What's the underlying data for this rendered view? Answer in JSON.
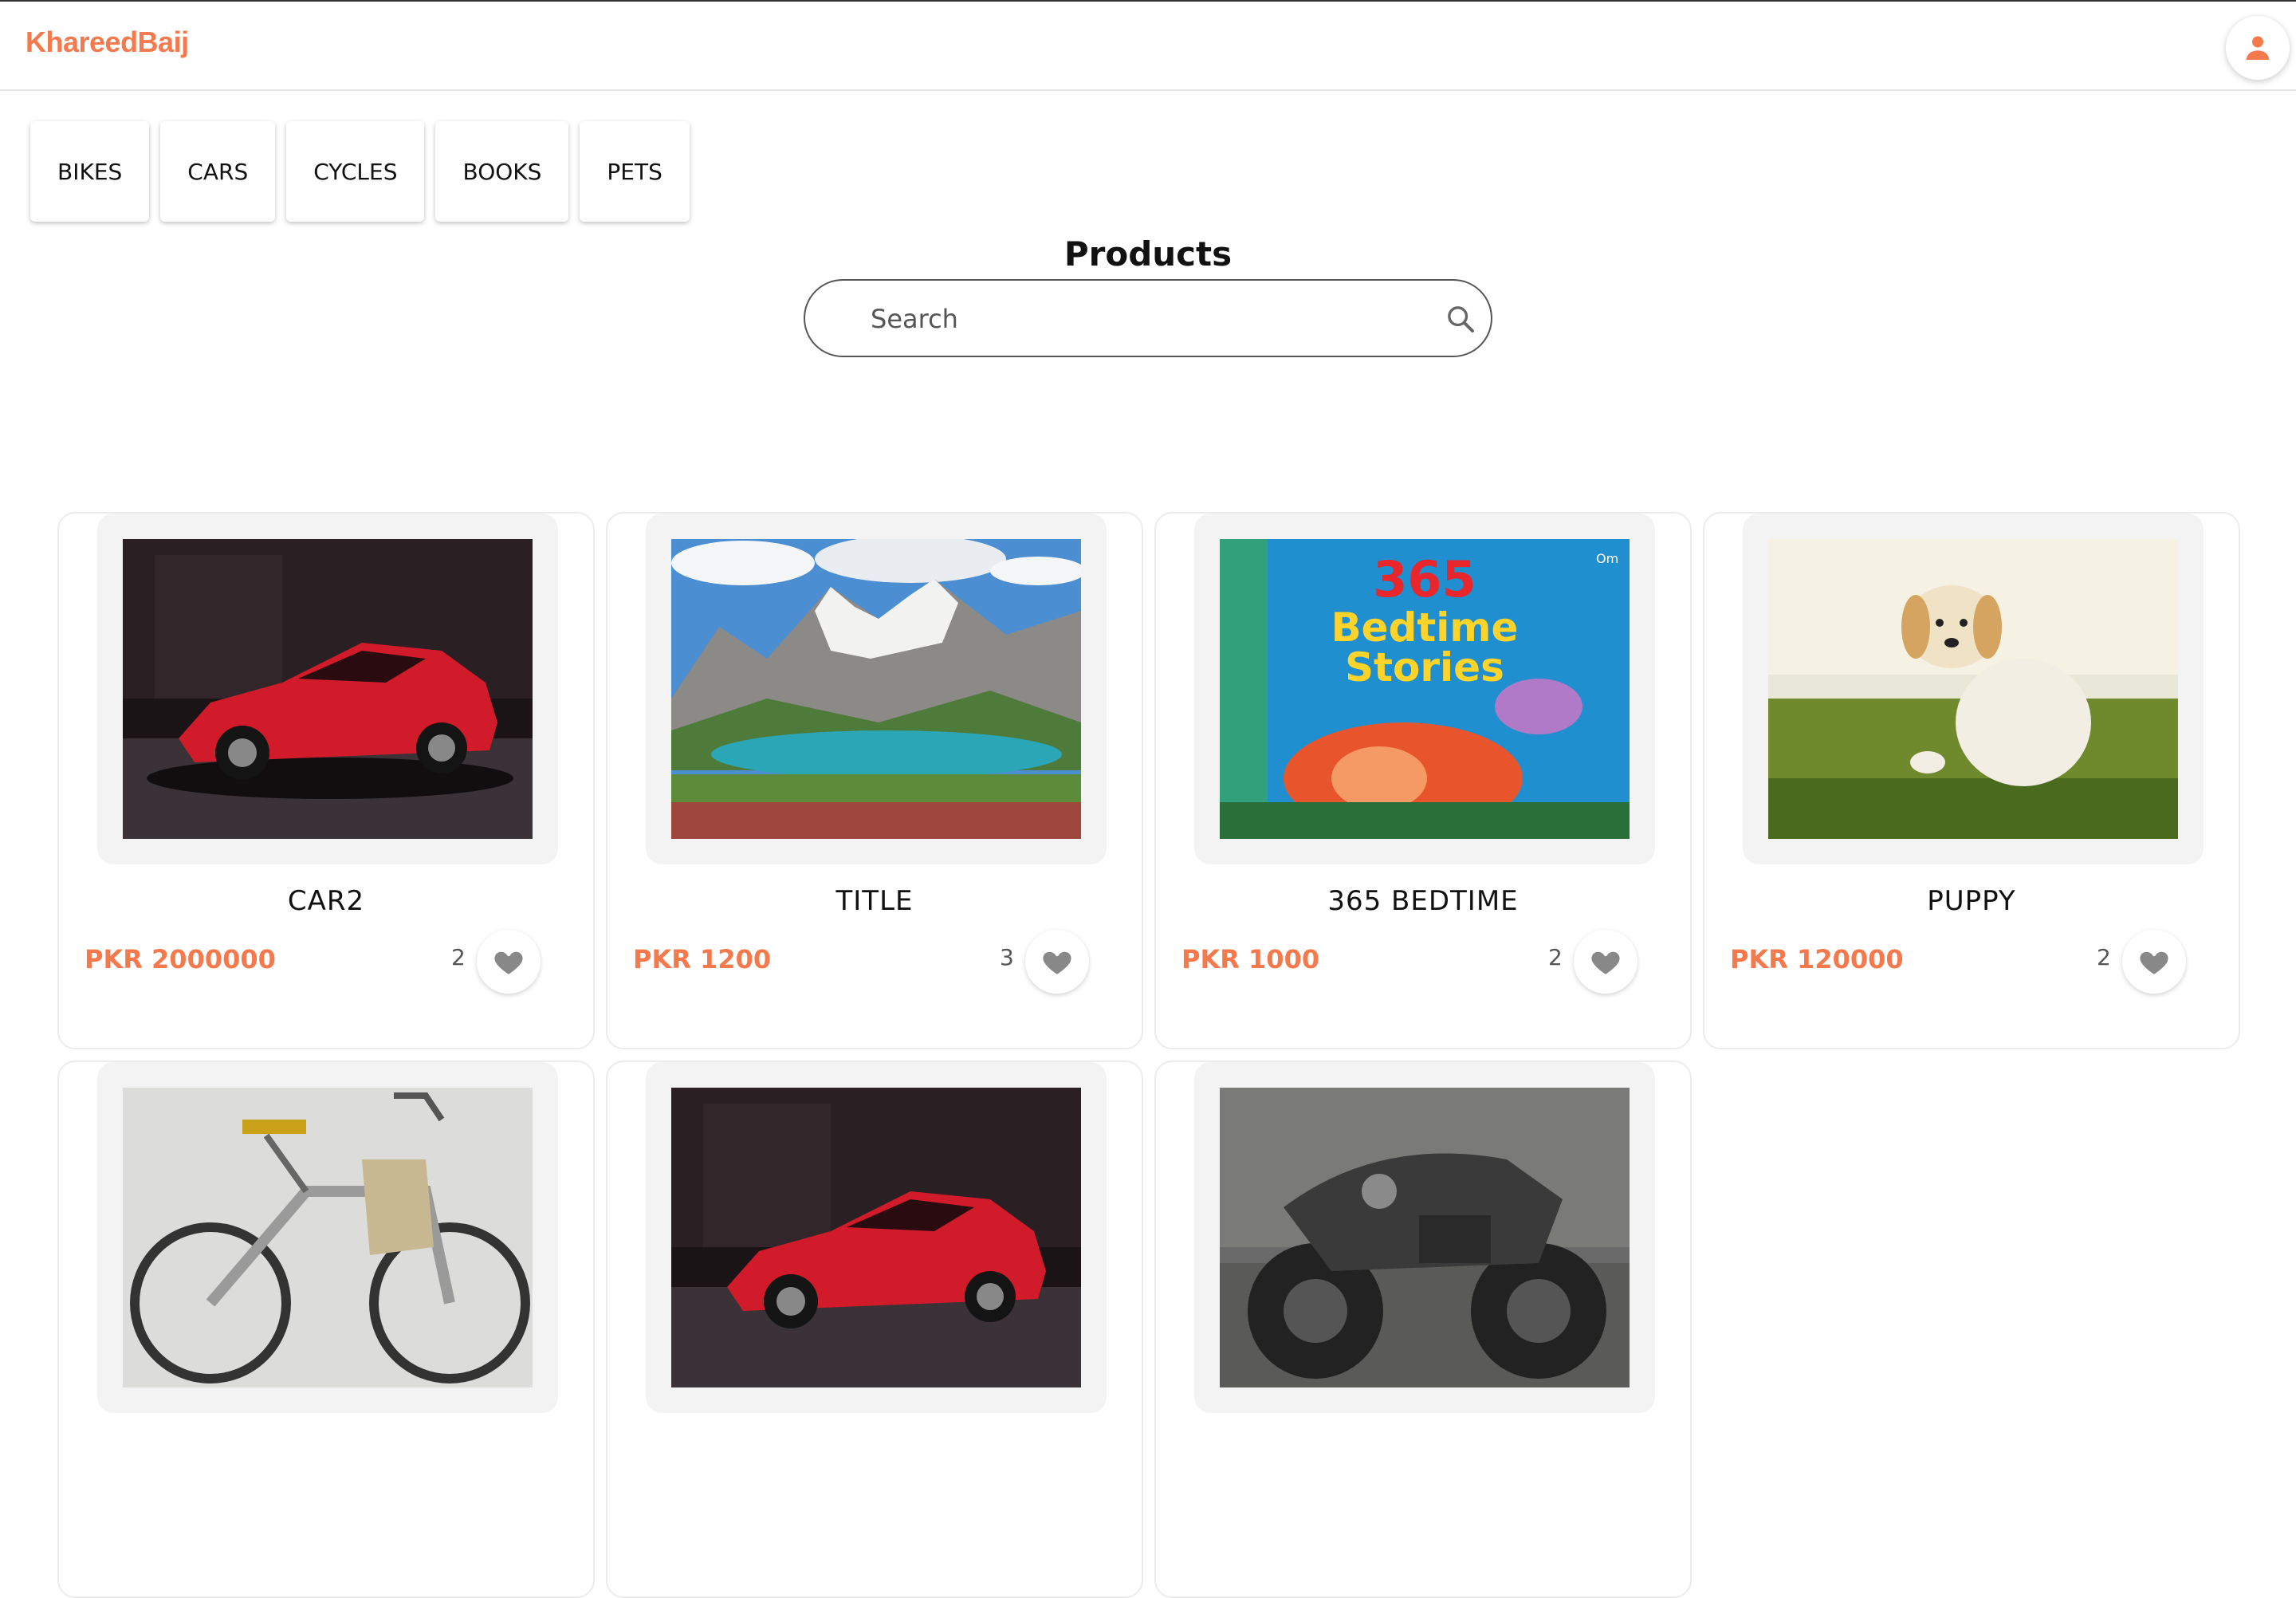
{
  "colors": {
    "accent": "#f47a4d",
    "text": "#111111",
    "icon_gray": "#888888"
  },
  "header": {
    "brand": "KhareedBaij",
    "profile_icon": "person-icon"
  },
  "categories": [
    "BIKES",
    "CARS",
    "CYCLES",
    "BOOKS",
    "PETS"
  ],
  "main": {
    "title": "Products",
    "search_placeholder": "Search",
    "search_icon": "search-icon"
  },
  "products": [
    {
      "title": "CAR2",
      "price": "PKR 2000000",
      "likes": "2",
      "image": "red sports car"
    },
    {
      "title": "TITLE",
      "price": "PKR 1200",
      "likes": "3",
      "image": "mountain lake landscape"
    },
    {
      "title": "365 BEDTIME",
      "price": "PKR 1000",
      "likes": "2",
      "image": "365 Bedtime Stories book cover"
    },
    {
      "title": "PUPPY",
      "price": "PKR 120000",
      "likes": "2",
      "image": "golden retriever puppy"
    },
    {
      "title": "",
      "price": "",
      "likes": "",
      "image": "electric mountain bicycle"
    },
    {
      "title": "",
      "price": "",
      "likes": "",
      "image": "red sports car"
    },
    {
      "title": "",
      "price": "",
      "likes": "",
      "image": "dark custom motorcycle"
    }
  ],
  "book_cover_text": {
    "number": "365",
    "line1": "Bedtime",
    "line2": "Stories",
    "publisher": "Om"
  }
}
